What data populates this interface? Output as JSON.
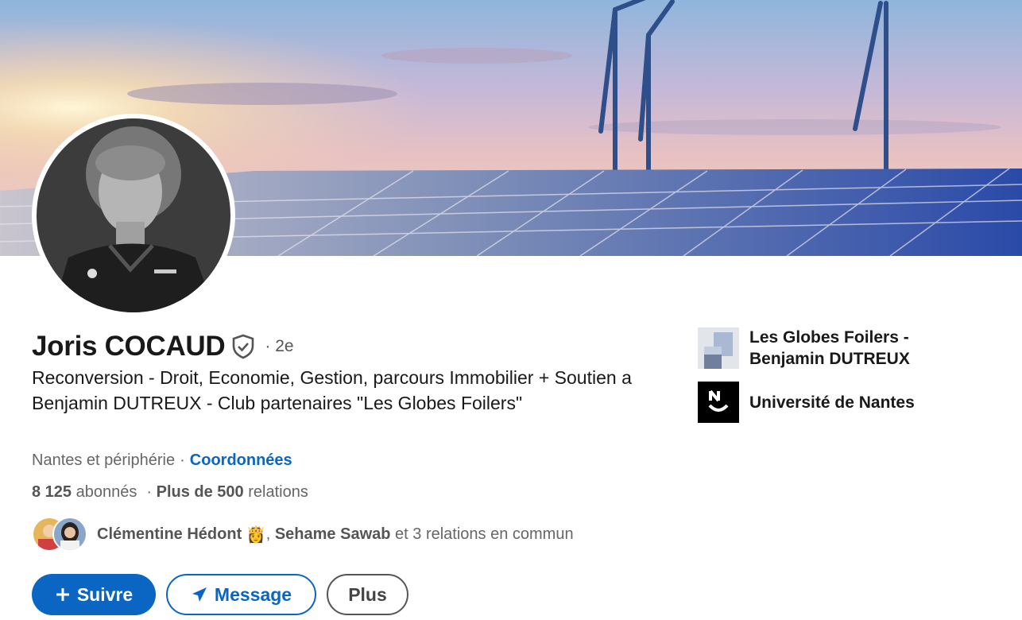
{
  "profile": {
    "name": "Joris COCAUD",
    "degree": "· 2e",
    "headline": "Reconversion - Droit, Economie, Gestion, parcours Immobilier + Soutien a Benjamin DUTREUX - Club partenaires \"Les Globes Foilers\"",
    "location": "Nantes et périphérie",
    "separator": "·",
    "contact_link": "Coordonnées",
    "followers_count": "8 125",
    "followers_label": "abonnés",
    "connections_prefix": "·",
    "connections_count": "Plus de 500",
    "connections_label": "relations",
    "mutual": {
      "first": "Clémentine Hédont",
      "emoji": "👸",
      "second": "Sehame Sawab",
      "rest": "et 3 relations en commun"
    }
  },
  "actions": {
    "follow_label": "Suivre",
    "message_label": "Message",
    "more_label": "Plus"
  },
  "organizations": [
    {
      "name": "Les Globes Foilers - Benjamin DUTREUX",
      "logo": "globes-foilers-logo"
    },
    {
      "name": "Université de Nantes",
      "logo": "universite-nantes-logo"
    }
  ],
  "colors": {
    "accent": "#0a66c2",
    "text": "#191919",
    "muted": "#666666"
  }
}
